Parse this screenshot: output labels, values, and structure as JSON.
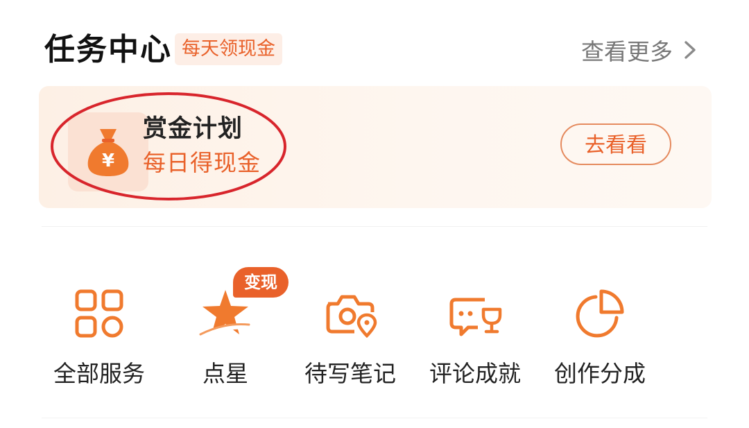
{
  "header": {
    "title": "任务中心",
    "tag": "每天领现金",
    "more_label": "查看更多"
  },
  "bounty": {
    "title": "赏金计划",
    "subtitle": "每日得现金",
    "button_label": "去看看",
    "icon": "money-bag-icon",
    "icon_glyph": "¥"
  },
  "services": [
    {
      "label": "全部服务",
      "icon": "grid-icon"
    },
    {
      "label": "点星",
      "icon": "star-icon",
      "badge": "变现"
    },
    {
      "label": "待写笔记",
      "icon": "camera-location-icon"
    },
    {
      "label": "评论成就",
      "icon": "comment-trophy-icon"
    },
    {
      "label": "创作分成",
      "icon": "pie-chart-icon"
    }
  ],
  "colors": {
    "accent": "#e9612a",
    "icon_orange": "#f07a2e",
    "card_bg": "#fdf0e5",
    "annotation_red": "#d8252c"
  }
}
